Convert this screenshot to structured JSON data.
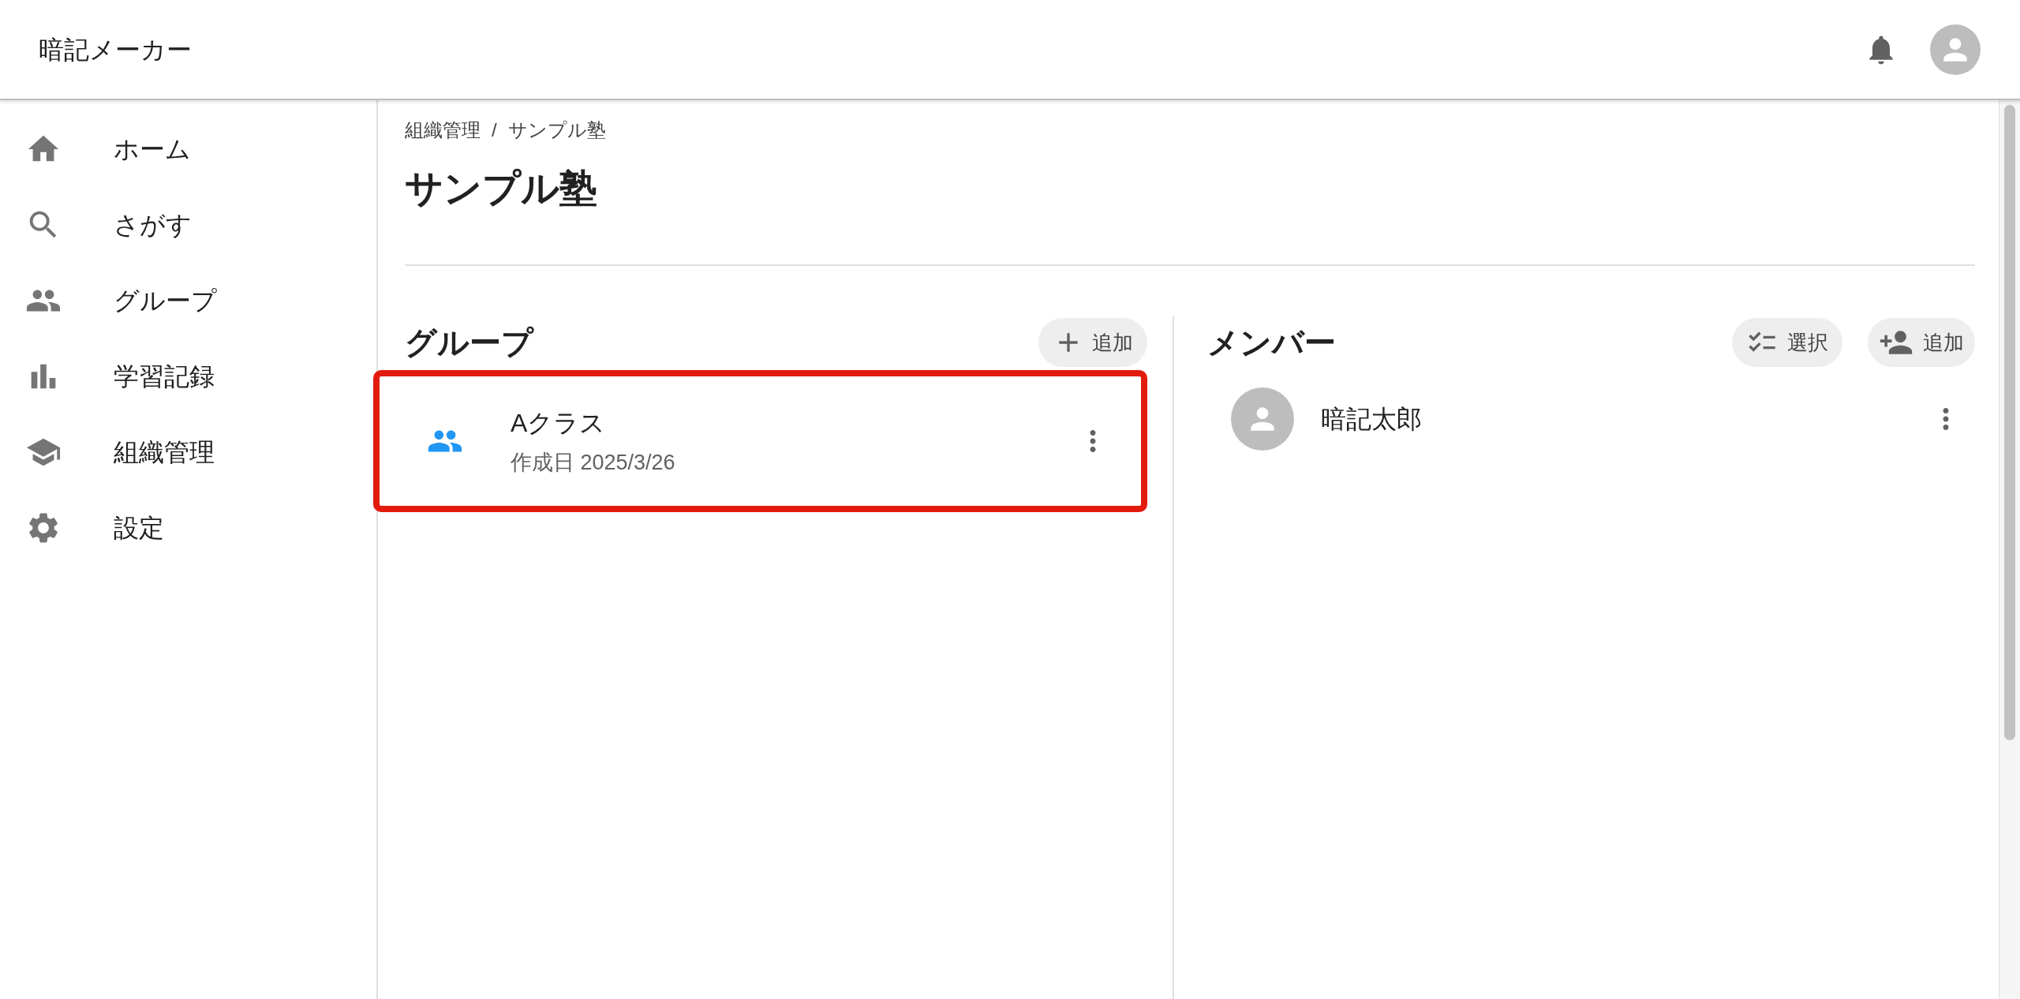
{
  "app_bar": {
    "title": "暗記メーカー"
  },
  "sidebar": {
    "items": [
      {
        "label": "ホーム",
        "selected": false
      },
      {
        "label": "さがす",
        "selected": false
      },
      {
        "label": "グループ",
        "selected": false
      },
      {
        "label": "学習記録",
        "selected": false
      },
      {
        "label": "組織管理",
        "selected": false
      },
      {
        "label": "設定",
        "selected": false
      }
    ]
  },
  "breadcrumb": [
    "組織管理",
    "/",
    "サンプル塾"
  ],
  "page_title": "サンプル塾",
  "groups": {
    "heading": "グループ",
    "add_button": "追加",
    "items": [
      {
        "name": "Aクラス",
        "created": "作成日 2025/3/26",
        "highlighted": true
      }
    ]
  },
  "members": {
    "heading": "メンバー",
    "select_button": "選択",
    "add_button": "追加",
    "items": [
      {
        "name": "暗記太郎"
      }
    ]
  }
}
